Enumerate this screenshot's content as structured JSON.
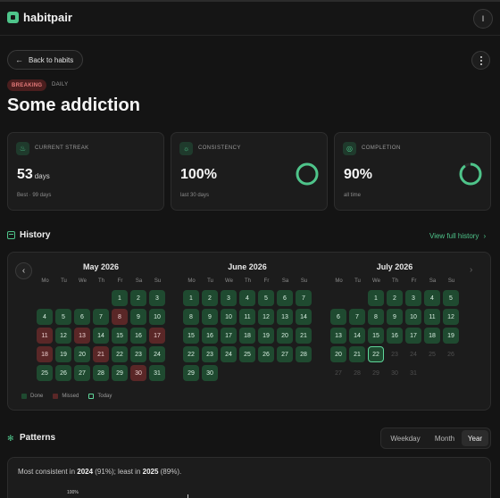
{
  "app": {
    "name": "habitpair",
    "user_initial": "I"
  },
  "nav": {
    "back_label": "Back to habits"
  },
  "habit": {
    "badge": "BREAKING",
    "type": "DAILY",
    "title": "Some addiction"
  },
  "stats": {
    "streak": {
      "label": "CURRENT STREAK",
      "value": "53",
      "unit": "days",
      "sub": "Best · 99 days"
    },
    "consistency": {
      "label": "CONSISTENCY",
      "value": "100%",
      "sub": "last 30 days",
      "fraction": 1.0
    },
    "completion": {
      "label": "COMPLETION",
      "value": "90%",
      "sub": "all time",
      "fraction": 0.9
    }
  },
  "history": {
    "title": "History",
    "view_full": "View full history",
    "weekdays": [
      "Mo",
      "Tu",
      "We",
      "Th",
      "Fr",
      "Sa",
      "Su"
    ],
    "months": [
      {
        "name": "May 2026",
        "offset": 4,
        "days": 31,
        "missed": [
          8,
          11,
          13,
          17,
          18,
          21,
          30
        ],
        "today": null,
        "future_from": null
      },
      {
        "name": "June 2026",
        "offset": 0,
        "days": 30,
        "missed": [],
        "today": null,
        "future_from": null
      },
      {
        "name": "July 2026",
        "offset": 2,
        "days": 31,
        "missed": [],
        "today": 22,
        "future_from": 23
      }
    ],
    "legend": {
      "done": "Done",
      "missed": "Missed",
      "today": "Today"
    }
  },
  "patterns": {
    "title": "Patterns",
    "tabs": [
      "Weekday",
      "Month",
      "Year"
    ],
    "active_tab": "Year",
    "summary": {
      "prefix": "Most consistent in ",
      "best_year": "2024",
      "best_pct": " (91%); least in ",
      "worst_year": "2025",
      "worst_pct": " (89%)."
    },
    "axis_top": "100%"
  },
  "colors": {
    "accent": "#4ec48a",
    "done": "#1f4a30",
    "missed": "#5a2727",
    "danger_text": "#e57a7a"
  }
}
